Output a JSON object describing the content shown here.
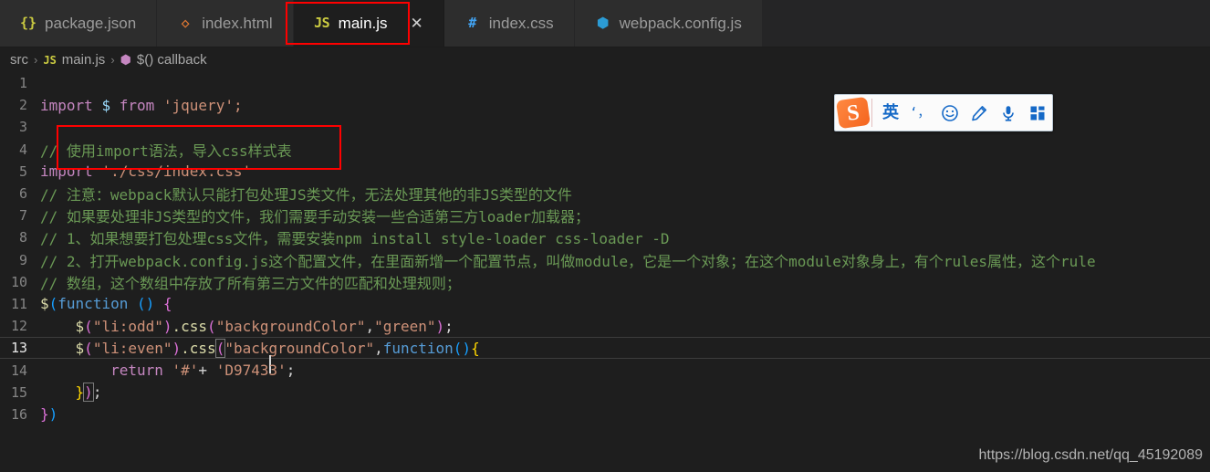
{
  "tabs": [
    {
      "icon": "json-braces-icon",
      "glyph": "{}",
      "icon_class": "icon-json",
      "label": "package.json",
      "active": false,
      "closable": false
    },
    {
      "icon": "html-chevrons-icon",
      "glyph": "◇",
      "icon_class": "icon-html",
      "label": "index.html",
      "active": false,
      "closable": false
    },
    {
      "icon": "javascript-icon",
      "glyph": "JS",
      "icon_class": "icon-js",
      "label": "main.js",
      "active": true,
      "closable": true,
      "close_glyph": "✕"
    },
    {
      "icon": "css-hash-icon",
      "glyph": "#",
      "icon_class": "icon-css",
      "label": "index.css",
      "active": false,
      "closable": false
    },
    {
      "icon": "webpack-cube-icon",
      "glyph": "⬢",
      "icon_class": "icon-webpack",
      "label": "webpack.config.js",
      "active": false,
      "closable": false
    }
  ],
  "breadcrumb": {
    "items": [
      {
        "label": "src",
        "icon": null
      },
      {
        "label": "main.js",
        "icon": "javascript-icon",
        "glyph": "JS",
        "icon_class": "bc-js"
      },
      {
        "label": "$() callback",
        "icon": "symbol-cube-icon",
        "glyph": "⬢",
        "icon_class": "bc-cube"
      }
    ],
    "separator": "›"
  },
  "editor": {
    "active_line": 13,
    "lines": [
      {
        "n": "1",
        "text": ""
      },
      {
        "n": "2",
        "text": "import $ from 'jquery';"
      },
      {
        "n": "3",
        "text": ""
      },
      {
        "n": "4",
        "text": "// 使用import语法，导入css样式表"
      },
      {
        "n": "5",
        "text": "import './css/index.css'"
      },
      {
        "n": "6",
        "text": "// 注意：webpack默认只能打包处理JS类文件，无法处理其他的非JS类型的文件"
      },
      {
        "n": "7",
        "text": "// 如果要处理非JS类型的文件，我们需要手动安装一些合适第三方loader加载器；"
      },
      {
        "n": "8",
        "text": "// 1、如果想要打包处理css文件，需要安装npm install style-loader css-loader -D"
      },
      {
        "n": "9",
        "text": "// 2、打开webpack.config.js这个配置文件，在里面新增一个配置节点，叫做module，它是一个对象；在这个module对象身上，有个rules属性，这个rule"
      },
      {
        "n": "10",
        "text": "// 数组，这个数组中存放了所有第三方文件的匹配和处理规则；"
      },
      {
        "n": "11",
        "text": "$(function () {"
      },
      {
        "n": "12",
        "text": "    $(\"li:odd\").css(\"backgroundColor\",\"green\");"
      },
      {
        "n": "13",
        "text": "    $(\"li:even\").css(\"backgroundColor\",function(){"
      },
      {
        "n": "14",
        "text": "        return '#'+ 'D97433';"
      },
      {
        "n": "15",
        "text": "    });"
      },
      {
        "n": "16",
        "text": "})"
      }
    ]
  },
  "code_tokens": {
    "l2": {
      "kw_import": "import",
      "var_dollar": "$",
      "kw_from": "from",
      "str_jquery": "'jquery';"
    },
    "l4": {
      "comment": "// 使用import语法，导入css样式表"
    },
    "l5": {
      "kw_import": "import",
      "str_path": "'./css/index.css'"
    },
    "l6": {
      "comment": "// 注意：webpack默认只能打包处理JS类文件，无法处理其他的非JS类型的文件"
    },
    "l7": {
      "comment": "// 如果要处理非JS类型的文件，我们需要手动安装一些合适第三方loader加载器；"
    },
    "l8": {
      "comment": "// 1、如果想要打包处理css文件，需要安装npm install style-loader css-loader -D"
    },
    "l9": {
      "comment": "// 2、打开webpack.config.js这个配置文件，在里面新增一个配置节点，叫做module，它是一个对象；在这个module对象身上，有个rules属性，这个rule"
    },
    "l10": {
      "comment": "// 数组，这个数组中存放了所有第三方文件的匹配和处理规则；"
    },
    "l11": {
      "dollar": "$",
      "paren_open": "(",
      "kw_function": "function",
      "args": " () ",
      "brace": "{"
    },
    "l12": {
      "dollar": "$",
      "p1": "(",
      "sel": "\"li:odd\"",
      "p1c": ")",
      "dot_css": ".css",
      "p2": "(",
      "prop": "\"backgroundColor\"",
      "comma": ",",
      "val": "\"green\"",
      "p2c": ")",
      "semi": ";"
    },
    "l13": {
      "dollar": "$",
      "p1": "(",
      "sel": "\"li:even\"",
      "p1c": ")",
      "dot_css": ".css",
      "p2": "(",
      "prop_a": "\"back",
      "prop_b": "groundColor\"",
      "comma": ",",
      "kw_function": "function",
      "parens": "()",
      "brace": "{"
    },
    "l14": {
      "kw_return": "return",
      "str_hash": "'#'",
      "plus": "+",
      "str_color": "'D97433'",
      "semi": ";"
    },
    "l15": {
      "brace_close": "}",
      "paren_close": ")",
      "semi": ";"
    },
    "l16": {
      "brace_close": "}",
      "paren_close": ")"
    }
  },
  "annotations": {
    "tab_box_color": "#ff0000",
    "code_box_color": "#ff0000"
  },
  "ime_toolbar": {
    "logo": "S",
    "items": [
      {
        "name": "language-mode-english",
        "glyph": "英"
      },
      {
        "name": "punctuation-mode",
        "glyph": "‘，"
      },
      {
        "name": "emoji-icon",
        "glyph": "☺"
      },
      {
        "name": "handwriting-pen-icon",
        "glyph": "✎"
      },
      {
        "name": "microphone-icon",
        "glyph": "Ἲ4"
      },
      {
        "name": "toolbox-grid-icon",
        "glyph": "▦"
      }
    ]
  },
  "watermark": {
    "text": "https://blog.csdn.net/qq_45192089"
  },
  "colors": {
    "editor_bg": "#1e1e1e",
    "tabbar_bg": "#252526",
    "tab_inactive_bg": "#2d2d2d",
    "comment_green": "#6a9955",
    "string_orange": "#ce9178",
    "keyword_purple": "#c586c0",
    "annotation_red": "#ff0000",
    "ime_blue": "#1569c7",
    "ime_orange": "#f4641e"
  }
}
